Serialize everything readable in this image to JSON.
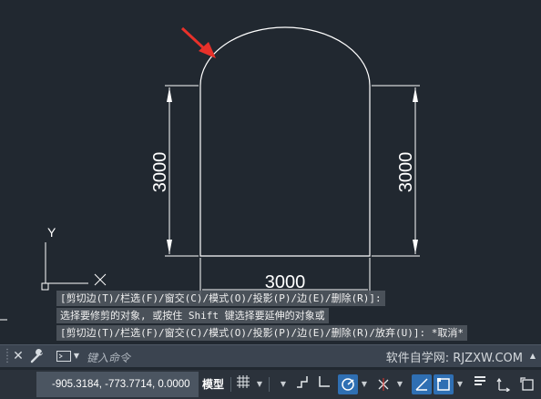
{
  "drawing": {
    "dim_left": "3000",
    "dim_right": "3000",
    "dim_bottom": "3000",
    "ucs_y_label": "Y",
    "ucs_x_label": "X",
    "colors": {
      "background": "#212830",
      "lines": "#ffffff",
      "arrow_annotation": "#e8312a"
    }
  },
  "command_history": [
    "[剪切边(T)/栏选(F)/窗交(C)/模式(O)/投影(P)/边(E)/删除(R)]:",
    "选择要修剪的对象, 或按住 Shift 键选择要延伸的对象或",
    "[剪切边(T)/栏选(F)/窗交(C)/模式(O)/投影(P)/边(E)/删除(R)/放弃(U)]: *取消*"
  ],
  "command_line": {
    "placeholder": "键入命令",
    "watermark": "软件自学网: RJZXW.COM",
    "icons": [
      "grip-icon",
      "close-icon",
      "wrench-icon",
      "terminal-icon",
      "chevron-down-icon",
      "chevron-up-icon"
    ]
  },
  "status_bar": {
    "coordinates": "-905.3184, -773.7714, 0.0000",
    "model_tab": "模型",
    "icons": [
      "grid-icon",
      "snap-icon",
      "ortho-icon",
      "polar-icon",
      "osnap-tracking-icon",
      "object-snap-icon",
      "lineweight-icon",
      "selection-cycling-icon",
      "properties-icon",
      "annotation-scale-icon",
      "workspace-icon"
    ],
    "active_color": "#2f6fb3"
  }
}
